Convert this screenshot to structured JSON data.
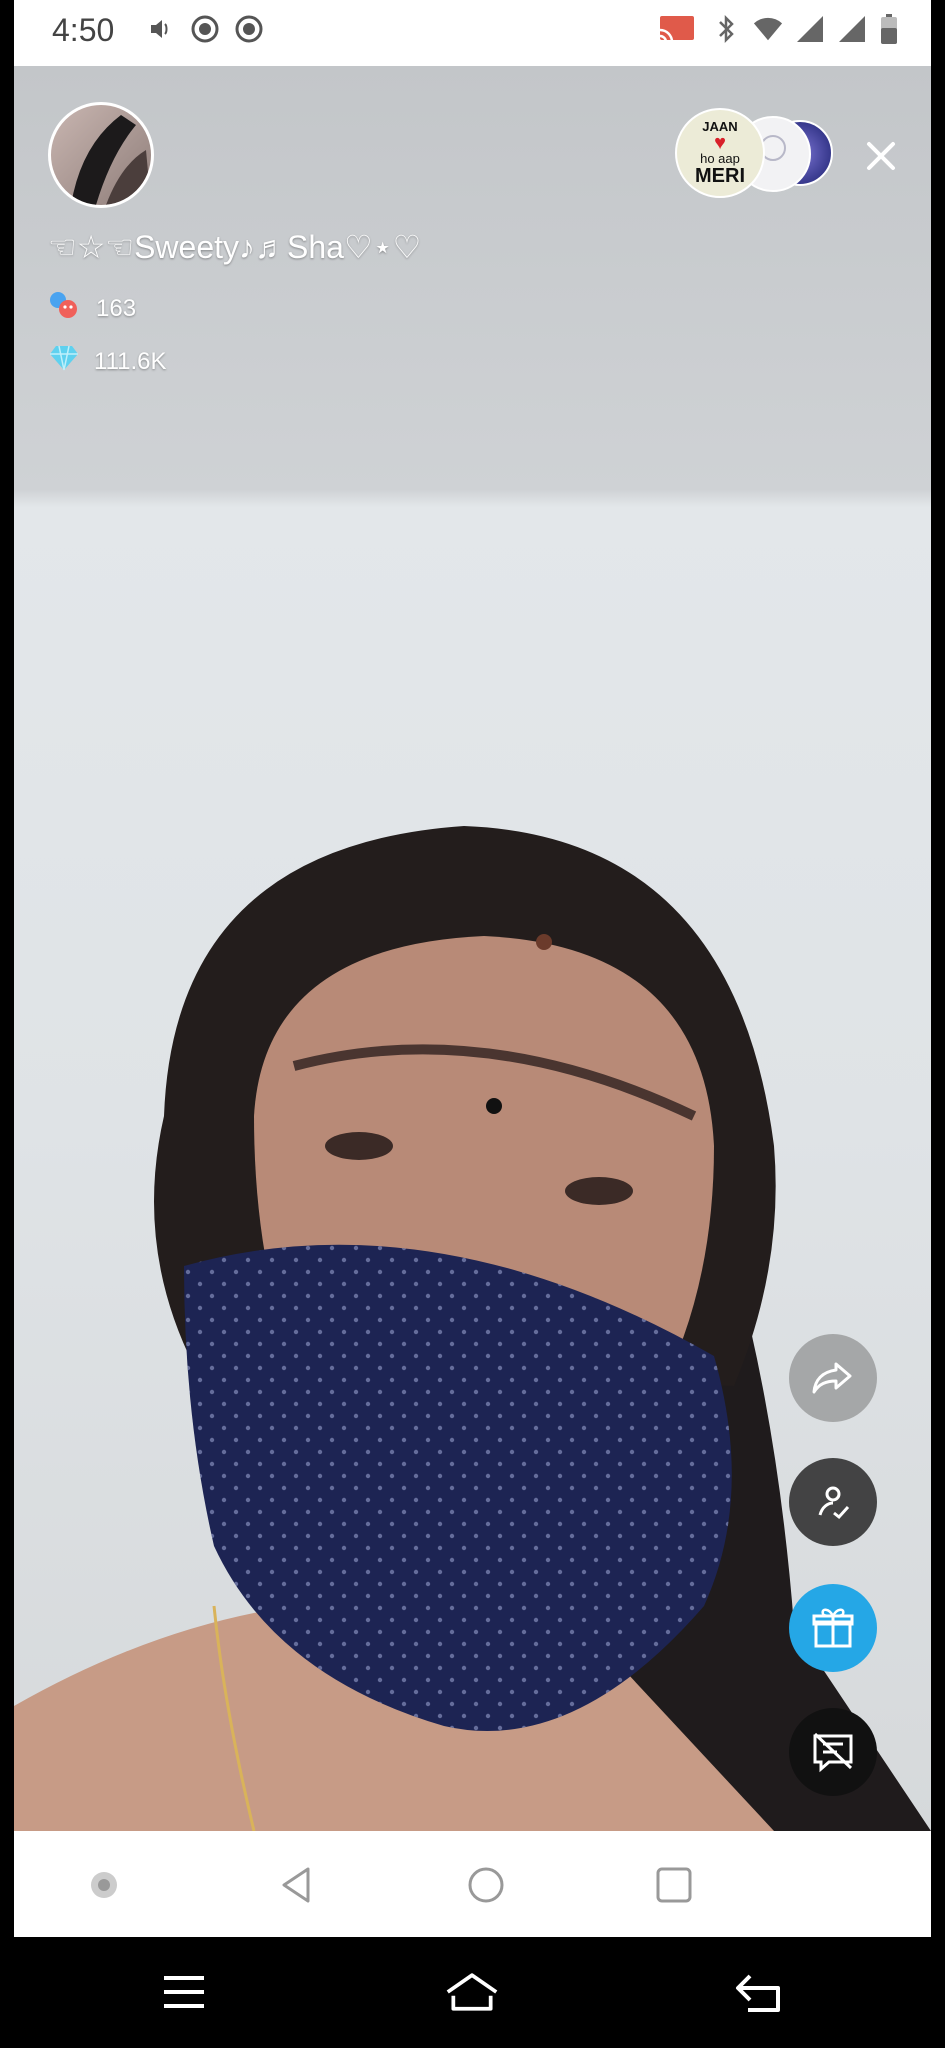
{
  "status_bar": {
    "time": "4:50",
    "left_icons": [
      "volume-icon",
      "record-icon",
      "record-icon"
    ],
    "right_icons": [
      "cast-icon",
      "bluetooth-icon",
      "wifi-icon",
      "signal-icon",
      "signal-icon",
      "battery-icon"
    ]
  },
  "live": {
    "host_name": "☜☆☜Sweety♪♬Sha♡⋆♡",
    "viewer_count": "163",
    "diamond_count": "111.6K",
    "top_viewer_badge": [
      "JAAN",
      "♥",
      "ho aap",
      "MERI"
    ]
  },
  "colors": {
    "gift_button": "#25a7e6",
    "status_bar_bg": "#ffffff",
    "nav_bg": "#000000"
  }
}
